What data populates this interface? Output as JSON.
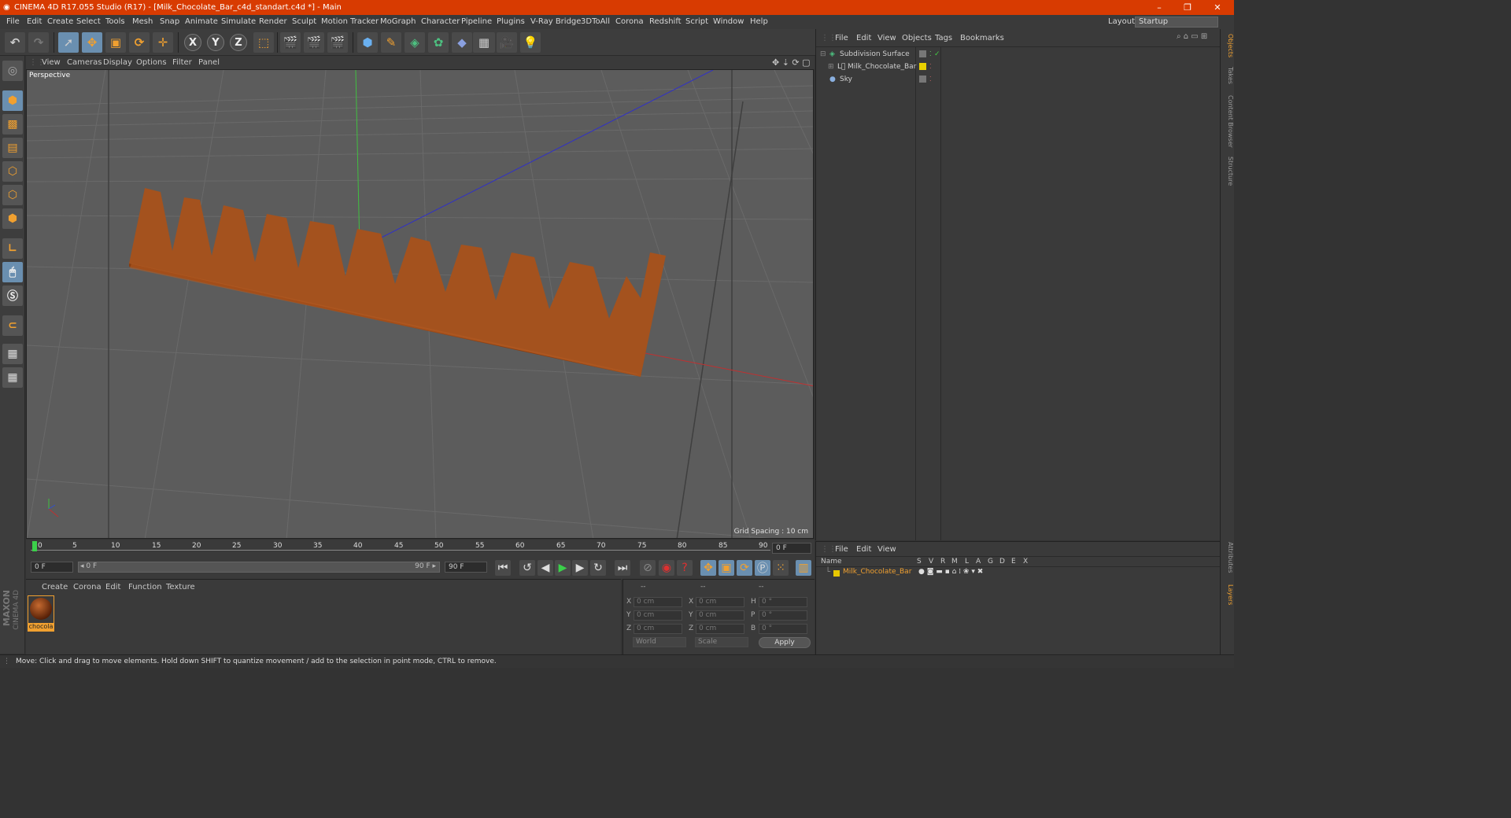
{
  "window": {
    "title": "CINEMA 4D R17.055 Studio (R17) - [Milk_Chocolate_Bar_c4d_standart.c4d *] - Main",
    "controls": [
      "–",
      "❐",
      "✕"
    ]
  },
  "menubar": {
    "items": [
      "File",
      "Edit",
      "Create",
      "Select",
      "Tools",
      "Mesh",
      "Snap",
      "Animate",
      "Simulate",
      "Render",
      "Sculpt",
      "Motion Tracker",
      "MoGraph",
      "Character",
      "Pipeline",
      "Plugins",
      "V-Ray Bridge",
      "3DToAll",
      "Corona",
      "Redshift",
      "Script",
      "Window",
      "Help"
    ],
    "layout_label": "Layout:",
    "layout_value": "Startup"
  },
  "toolbar": {
    "axis_x": "X",
    "axis_y": "Y",
    "axis_z": "Z"
  },
  "viewport": {
    "menu": [
      "View",
      "Cameras",
      "Display",
      "Options",
      "Filter",
      "Panel"
    ],
    "label": "Perspective",
    "grid_spacing": "Grid Spacing : 10 cm"
  },
  "timeline": {
    "ticks": [
      "0",
      "5",
      "10",
      "15",
      "20",
      "25",
      "30",
      "35",
      "40",
      "45",
      "50",
      "55",
      "60",
      "65",
      "70",
      "75",
      "80",
      "85",
      "90"
    ],
    "current_frame": "0 F",
    "start_field": "0 F",
    "range_start": "◂ 0 F",
    "range_end": "90 F ▸",
    "end_field": "90 F"
  },
  "material_panel": {
    "menu": [
      "Create",
      "Corona",
      "Edit",
      "Function",
      "Texture"
    ],
    "material_name": "chocola"
  },
  "coord_panel": {
    "headers": [
      "--",
      "--",
      "--"
    ],
    "rows": [
      {
        "l1": "X",
        "v1": "0 cm",
        "l2": "X",
        "v2": "0 cm",
        "l3": "H",
        "v3": "0 °"
      },
      {
        "l1": "Y",
        "v1": "0 cm",
        "l2": "Y",
        "v2": "0 cm",
        "l3": "P",
        "v3": "0 °"
      },
      {
        "l1": "Z",
        "v1": "0 cm",
        "l2": "Z",
        "v2": "0 cm",
        "l3": "B",
        "v3": "0 °"
      }
    ],
    "world": "World",
    "scale": "Scale",
    "apply": "Apply"
  },
  "object_panel": {
    "menu": [
      "File",
      "Edit",
      "View",
      "Objects",
      "Tags",
      "Bookmarks"
    ],
    "objects": [
      {
        "name": "Subdivision Surface"
      },
      {
        "name": "Milk_Chocolate_Bar"
      },
      {
        "name": "Sky"
      }
    ]
  },
  "layer_panel": {
    "menu": [
      "File",
      "Edit",
      "View"
    ],
    "col_name": "Name",
    "cols": [
      "S",
      "V",
      "R",
      "M",
      "L",
      "A",
      "G",
      "D",
      "E",
      "X"
    ],
    "layer_name": "Milk_Chocolate_Bar",
    "layer_color": "#e8c800"
  },
  "right_tabs": [
    "Objects",
    "Takes",
    "Content Browser",
    "Structure",
    "Attributes",
    "Layers"
  ],
  "status": {
    "text": "Move: Click and drag to move elements. Hold down SHIFT to quantize movement / add to the selection in point mode, CTRL to remove."
  },
  "brand": {
    "line1": "MAXON",
    "line2": "CINEMA 4D"
  },
  "colors": {
    "titlebar": "#d83b01",
    "accent": "#f0a030",
    "chocolate": "#a4521e"
  }
}
